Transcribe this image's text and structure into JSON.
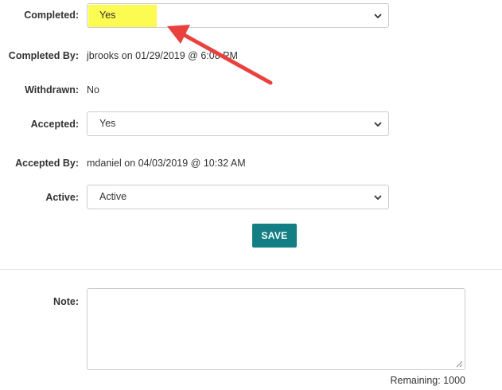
{
  "form": {
    "completed": {
      "label": "Completed:",
      "value": "Yes"
    },
    "completed_by": {
      "label": "Completed By:",
      "value": "jbrooks on 01/29/2019 @ 6:08 PM"
    },
    "withdrawn": {
      "label": "Withdrawn:",
      "value": "No"
    },
    "accepted": {
      "label": "Accepted:",
      "value": "Yes"
    },
    "accepted_by": {
      "label": "Accepted By:",
      "value": "mdaniel on 04/03/2019 @ 10:32 AM"
    },
    "active": {
      "label": "Active:",
      "value": "Active"
    },
    "save_label": "SAVE"
  },
  "note": {
    "label": "Note:",
    "value": "",
    "remaining": "Remaining: 1000"
  },
  "colors": {
    "highlight": "#fbfb52",
    "save_button": "#137e83",
    "arrow": "#e8413e"
  }
}
